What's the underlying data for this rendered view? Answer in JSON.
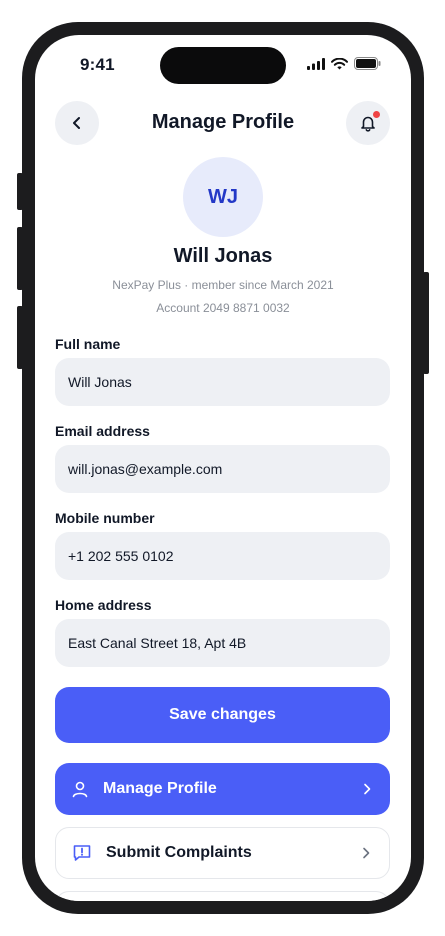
{
  "status_bar": {
    "time": "9:41"
  },
  "header": {
    "title": "Manage Profile",
    "back_icon": "chevron-left-icon",
    "notification_icon": "bell-icon",
    "notification_dot_color": "#ef4444"
  },
  "profile": {
    "initials": "WJ",
    "name": "Will Jonas",
    "membership": "NexPay Plus · member since March 2021",
    "account": "Account 2049 8871 0032"
  },
  "form": {
    "full_name": {
      "label": "Full name",
      "value": "Will Jonas"
    },
    "email": {
      "label": "Email address",
      "value": "will.jonas@example.com"
    },
    "mobile": {
      "label": "Mobile number",
      "value": "+1 202 555 0102"
    },
    "home_address": {
      "label": "Home address",
      "value": "East Canal Street 18, Apt 4B"
    },
    "save_label": "Save changes"
  },
  "menu": {
    "items": [
      {
        "label": "Manage Profile",
        "icon": "user-icon",
        "active": true
      },
      {
        "label": "Submit Complaints",
        "icon": "message-alert-icon",
        "active": false
      }
    ]
  },
  "colors": {
    "accent": "#4a5ef7",
    "field_bg": "#eef0f4",
    "avatar_bg": "#e7ebfb",
    "avatar_text": "#2338c7"
  }
}
